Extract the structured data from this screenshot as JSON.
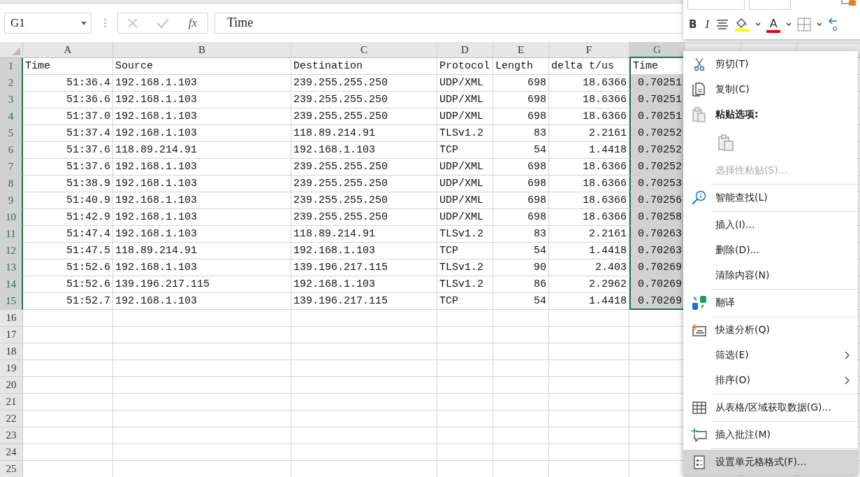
{
  "formula_bar": {
    "name_box": "G1",
    "function_label": "fx",
    "formula": "Time"
  },
  "mini_toolbar": {
    "bold": "B",
    "italic": "I",
    "font_color": "A"
  },
  "columns": [
    {
      "letter": "A",
      "selected": false,
      "numeric": true
    },
    {
      "letter": "B",
      "selected": false,
      "numeric": false
    },
    {
      "letter": "C",
      "selected": false,
      "numeric": false
    },
    {
      "letter": "D",
      "selected": false,
      "numeric": false
    },
    {
      "letter": "E",
      "selected": false,
      "numeric": true
    },
    {
      "letter": "F",
      "selected": false,
      "numeric": true
    },
    {
      "letter": "G",
      "selected": true,
      "numeric": true
    }
  ],
  "rows": [
    {
      "number": "1",
      "selected": true,
      "kind": "header",
      "cells": [
        "Time",
        "Source",
        "Destination",
        "Protocol",
        "Length",
        "delta t/us",
        "Time"
      ]
    },
    {
      "number": "2",
      "selected": true,
      "kind": "data",
      "cells": [
        "51:36.4",
        "192.168.1.103",
        "239.255.255.250",
        "UDP/XML",
        "698",
        "18.6366",
        "0.70251"
      ]
    },
    {
      "number": "3",
      "selected": true,
      "kind": "data",
      "cells": [
        "51:36.6",
        "192.168.1.103",
        "239.255.255.250",
        "UDP/XML",
        "698",
        "18.6366",
        "0.70251"
      ]
    },
    {
      "number": "4",
      "selected": true,
      "kind": "data",
      "cells": [
        "51:37.0",
        "192.168.1.103",
        "239.255.255.250",
        "UDP/XML",
        "698",
        "18.6366",
        "0.70251"
      ]
    },
    {
      "number": "5",
      "selected": true,
      "kind": "data",
      "cells": [
        "51:37.4",
        "192.168.1.103",
        "118.89.214.91",
        "TLSv1.2",
        "83",
        "2.2161",
        "0.70252"
      ]
    },
    {
      "number": "6",
      "selected": true,
      "kind": "data",
      "cells": [
        "51:37.6",
        "118.89.214.91",
        "192.168.1.103",
        "TCP",
        "54",
        "1.4418",
        "0.70252"
      ]
    },
    {
      "number": "7",
      "selected": true,
      "kind": "data",
      "cells": [
        "51:37.6",
        "192.168.1.103",
        "239.255.255.250",
        "UDP/XML",
        "698",
        "18.6366",
        "0.70252"
      ]
    },
    {
      "number": "8",
      "selected": true,
      "kind": "data",
      "cells": [
        "51:38.9",
        "192.168.1.103",
        "239.255.255.250",
        "UDP/XML",
        "698",
        "18.6366",
        "0.70253"
      ]
    },
    {
      "number": "9",
      "selected": true,
      "kind": "data",
      "cells": [
        "51:40.9",
        "192.168.1.103",
        "239.255.255.250",
        "UDP/XML",
        "698",
        "18.6366",
        "0.70256"
      ]
    },
    {
      "number": "10",
      "selected": true,
      "kind": "data",
      "cells": [
        "51:42.9",
        "192.168.1.103",
        "239.255.255.250",
        "UDP/XML",
        "698",
        "18.6366",
        "0.70258"
      ]
    },
    {
      "number": "11",
      "selected": true,
      "kind": "data",
      "cells": [
        "51:47.4",
        "192.168.1.103",
        "118.89.214.91",
        "TLSv1.2",
        "83",
        "2.2161",
        "0.70263"
      ]
    },
    {
      "number": "12",
      "selected": true,
      "kind": "data",
      "cells": [
        "51:47.5",
        "118.89.214.91",
        "192.168.1.103",
        "TCP",
        "54",
        "1.4418",
        "0.70263"
      ]
    },
    {
      "number": "13",
      "selected": true,
      "kind": "data",
      "cells": [
        "51:52.6",
        "192.168.1.103",
        "139.196.217.115",
        "TLSv1.2",
        "90",
        "2.403",
        "0.70269"
      ]
    },
    {
      "number": "14",
      "selected": true,
      "kind": "data",
      "cells": [
        "51:52.6",
        "139.196.217.115",
        "192.168.1.103",
        "TLSv1.2",
        "86",
        "2.2962",
        "0.70269"
      ]
    },
    {
      "number": "15",
      "selected": true,
      "kind": "data",
      "cells": [
        "51:52.7",
        "192.168.1.103",
        "139.196.217.115",
        "TCP",
        "54",
        "1.4418",
        "0.70269"
      ]
    },
    {
      "number": "16",
      "selected": false,
      "kind": "data",
      "cells": []
    },
    {
      "number": "17",
      "selected": false,
      "kind": "data",
      "cells": []
    },
    {
      "number": "18",
      "selected": false,
      "kind": "data",
      "cells": []
    },
    {
      "number": "19",
      "selected": false,
      "kind": "data",
      "cells": []
    },
    {
      "number": "20",
      "selected": false,
      "kind": "data",
      "cells": []
    },
    {
      "number": "21",
      "selected": false,
      "kind": "data",
      "cells": []
    },
    {
      "number": "22",
      "selected": false,
      "kind": "data",
      "cells": []
    },
    {
      "number": "23",
      "selected": false,
      "kind": "data",
      "cells": []
    },
    {
      "number": "24",
      "selected": false,
      "kind": "data",
      "cells": []
    },
    {
      "number": "25",
      "selected": false,
      "kind": "data",
      "cells": []
    }
  ],
  "context_menu": [
    {
      "kind": "item",
      "label": "剪切(T)",
      "disabled": false,
      "submenu": false,
      "selected": false
    },
    {
      "kind": "item",
      "label": "复制(C)",
      "disabled": false,
      "submenu": false,
      "selected": false
    },
    {
      "kind": "heading",
      "label": "粘贴选项:"
    },
    {
      "kind": "paste-options"
    },
    {
      "kind": "item",
      "label": "选择性粘贴(S)...",
      "disabled": true,
      "submenu": false,
      "selected": false
    },
    {
      "kind": "separator"
    },
    {
      "kind": "item",
      "label": "智能查找(L)",
      "disabled": false,
      "submenu": false,
      "selected": false
    },
    {
      "kind": "separator"
    },
    {
      "kind": "item",
      "label": "插入(I)...",
      "disabled": false,
      "submenu": false,
      "selected": false
    },
    {
      "kind": "item",
      "label": "删除(D)...",
      "disabled": false,
      "submenu": false,
      "selected": false
    },
    {
      "kind": "item",
      "label": "清除内容(N)",
      "disabled": false,
      "submenu": false,
      "selected": false
    },
    {
      "kind": "separator"
    },
    {
      "kind": "item",
      "label": "翻译",
      "disabled": false,
      "submenu": false,
      "selected": false
    },
    {
      "kind": "separator"
    },
    {
      "kind": "item",
      "label": "快速分析(Q)",
      "disabled": false,
      "submenu": false,
      "selected": false
    },
    {
      "kind": "item",
      "label": "筛选(E)",
      "disabled": false,
      "submenu": true,
      "selected": false
    },
    {
      "kind": "item",
      "label": "排序(O)",
      "disabled": false,
      "submenu": true,
      "selected": false
    },
    {
      "kind": "separator"
    },
    {
      "kind": "item",
      "label": "从表格/区域获取数据(G)...",
      "disabled": false,
      "submenu": false,
      "selected": false
    },
    {
      "kind": "separator"
    },
    {
      "kind": "item",
      "label": "插入批注(M)",
      "disabled": false,
      "submenu": false,
      "selected": false
    },
    {
      "kind": "separator"
    },
    {
      "kind": "item",
      "label": "设置单元格格式(F)...",
      "disabled": false,
      "submenu": false,
      "selected": true
    }
  ]
}
